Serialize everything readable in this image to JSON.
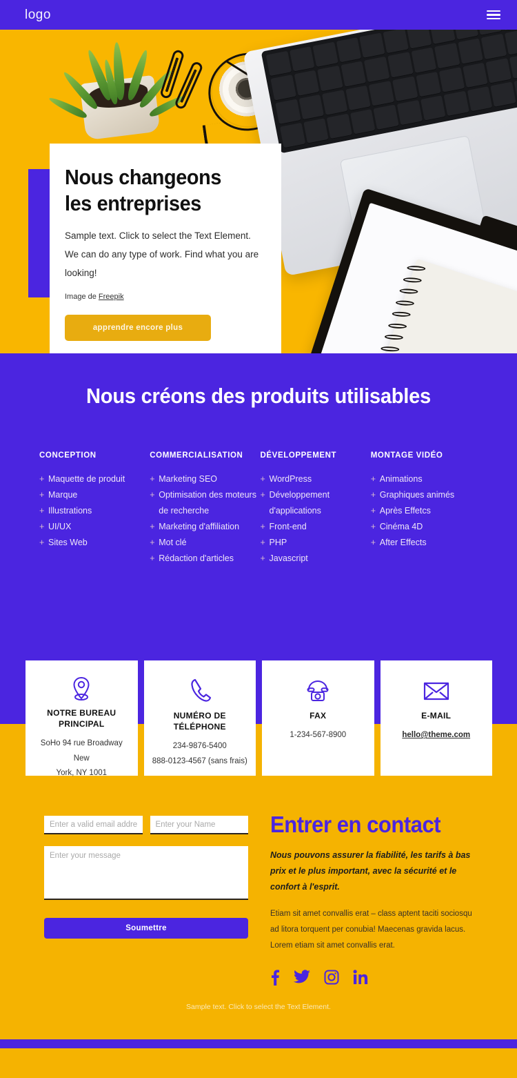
{
  "header": {
    "logo": "logo",
    "menu_icon": "hamburger-menu-icon"
  },
  "hero": {
    "title": "Nous changeons les entreprises",
    "subtitle": "Sample text. Click to select the Text Element. We can do any type of work. Find what you are looking!",
    "credit_prefix": "Image de ",
    "credit_link": "Freepik",
    "button": "apprendre encore plus"
  },
  "services": {
    "title": "Nous créons des produits utilisables",
    "columns": [
      {
        "heading": "CONCEPTION",
        "items": [
          "Maquette de produit",
          "Marque",
          "Illustrations",
          "UI/UX",
          "Sites Web"
        ]
      },
      {
        "heading": "COMMERCIALISATION",
        "items": [
          "Marketing SEO",
          "Optimisation des moteurs de recherche",
          "Marketing d'affiliation",
          "Mot clé",
          "Rédaction d'articles"
        ]
      },
      {
        "heading": "DÉVELOPPEMENT",
        "items": [
          "WordPress",
          "Développement d'applications",
          "Front-end",
          "PHP",
          "Javascript"
        ]
      },
      {
        "heading": "MONTAGE VIDÉO",
        "items": [
          "Animations",
          "Graphiques animés",
          "Après Effetcs",
          "Cinéma 4D",
          "After Effects"
        ]
      }
    ]
  },
  "contact_cards": [
    {
      "icon": "location-pin-icon",
      "title": "NOTRE BUREAU PRINCIPAL",
      "lines": [
        "SoHo 94 rue Broadway New",
        "York, NY 1001"
      ],
      "link": ""
    },
    {
      "icon": "phone-icon",
      "title": "NUMÉRO DE TÉLÉPHONE",
      "lines": [
        "234-9876-5400",
        "888-0123-4567 (sans frais)"
      ],
      "link": ""
    },
    {
      "icon": "fax-icon",
      "title": "FAX",
      "lines": [
        "1-234-567-8900"
      ],
      "link": ""
    },
    {
      "icon": "envelope-icon",
      "title": "E-MAIL",
      "lines": [],
      "link": "hello@theme.com"
    }
  ],
  "form": {
    "email_placeholder": "Enter a valid email address",
    "email_value": "",
    "name_placeholder": "Enter your Name",
    "name_value": "",
    "message_placeholder": "Enter your message",
    "message_value": "",
    "submit_label": "Soumettre"
  },
  "contact_text": {
    "title": "Entrer en contact",
    "lead": "Nous pouvons assurer la fiabilité, les tarifs à bas prix et le plus important, avec la sécurité et le confort à l'esprit.",
    "body": "Etiam sit amet convallis erat – class aptent taciti sociosqu ad litora torquent per conubia! Maecenas gravida lacus. Lorem etiam sit amet convallis erat.",
    "socials": [
      "facebook-icon",
      "twitter-icon",
      "instagram-icon",
      "linkedin-icon"
    ]
  },
  "footer": {
    "text": "Sample text. Click to select the Text Element."
  },
  "colors": {
    "purple": "#4B25E0",
    "yellow": "#F5B301",
    "hero_yellow": "#F9B600",
    "button_yellow": "#E8AC10",
    "white": "#FFFFFF"
  }
}
